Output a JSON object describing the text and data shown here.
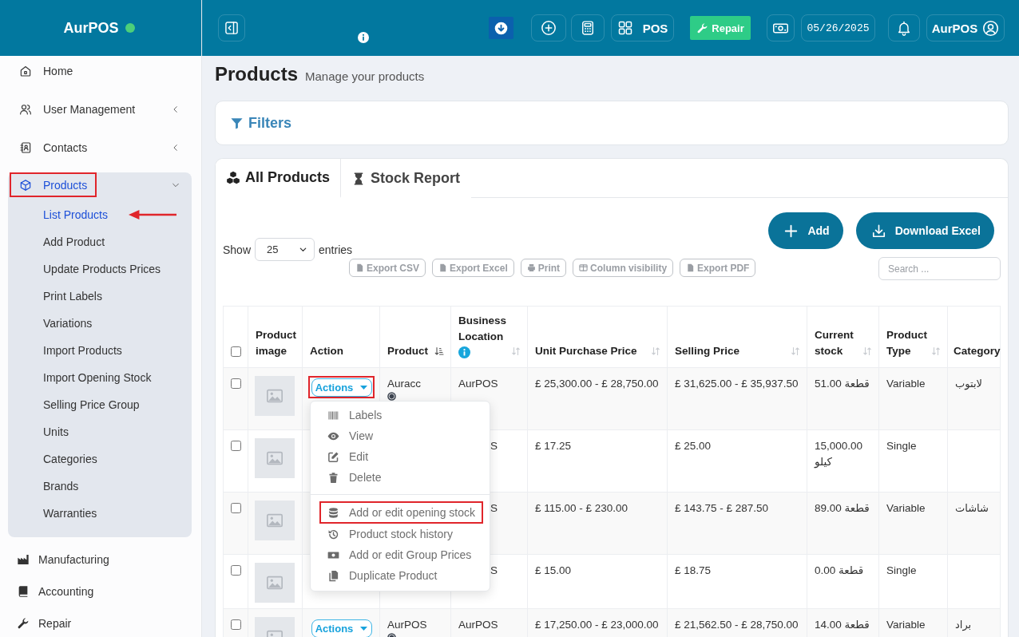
{
  "topbar": {
    "brand": "AurPOS",
    "online": true,
    "pos_label": "POS",
    "repair_label": "Repair",
    "date": "05/26/2025",
    "user": "AurPOS"
  },
  "sidebar": {
    "items": [
      {
        "label": "Home",
        "selected": false,
        "highlighted": false
      },
      {
        "label": "User Management",
        "selected": false,
        "highlighted": false,
        "expanded": false
      },
      {
        "label": "Contacts",
        "selected": false,
        "highlighted": false,
        "expanded": false
      },
      {
        "label": "Products",
        "selected": true,
        "highlighted": true,
        "expanded": true,
        "children": [
          {
            "label": "List Products",
            "selected": true,
            "arrow": true
          },
          {
            "label": "Add Product",
            "selected": false,
            "arrow": false
          },
          {
            "label": "Update Products Prices",
            "selected": false,
            "arrow": false
          },
          {
            "label": "Print Labels",
            "selected": false,
            "arrow": false
          },
          {
            "label": "Variations",
            "selected": false,
            "arrow": false
          },
          {
            "label": "Import Products",
            "selected": false,
            "arrow": false
          },
          {
            "label": "Import Opening Stock",
            "selected": false,
            "arrow": false
          },
          {
            "label": "Selling Price Group",
            "selected": false,
            "arrow": false
          },
          {
            "label": "Units",
            "selected": false,
            "arrow": false
          },
          {
            "label": "Categories",
            "selected": false,
            "arrow": false
          },
          {
            "label": "Brands",
            "selected": false,
            "arrow": false
          },
          {
            "label": "Warranties",
            "selected": false,
            "arrow": false
          }
        ]
      },
      {
        "label": "Manufacturing",
        "selected": false,
        "highlighted": false
      },
      {
        "label": "Accounting",
        "selected": false,
        "highlighted": false
      },
      {
        "label": "Repair",
        "selected": false,
        "highlighted": false
      }
    ]
  },
  "page": {
    "title": "Products",
    "subtitle": "Manage your products"
  },
  "filters": {
    "label": "Filters"
  },
  "tabs": [
    {
      "label": "All Products",
      "selected": true
    },
    {
      "label": "Stock Report",
      "selected": false
    }
  ],
  "panel": {
    "buttons": [
      "Add",
      "Download Excel"
    ],
    "show_label": "Show",
    "page_size": "25",
    "entries_label": "entries",
    "export_buttons": [
      "Export CSV",
      "Export Excel",
      "Print",
      "Column visibility",
      "Export PDF"
    ],
    "search": {
      "placeholder": "Search ..."
    }
  },
  "table": {
    "select_all": {
      "checked": false
    },
    "columns": [
      {
        "label": "Product image"
      },
      {
        "label": "Action"
      },
      {
        "label": "Product",
        "sorted": true
      },
      {
        "label": "Business Location",
        "sorted": false,
        "info": true
      },
      {
        "label": "Unit Purchase Price",
        "sorted": false
      },
      {
        "label": "Selling Price",
        "sorted": false
      },
      {
        "label": "Current stock",
        "sorted": false
      },
      {
        "label": "Product Type",
        "sorted": false
      },
      {
        "label": "Category"
      }
    ],
    "rows": [
      {
        "checked": false,
        "covered": false,
        "actions_label": "Actions",
        "highlighted": true,
        "menu_open": true,
        "menu_groups": [
          [
            {
              "label": "Labels",
              "highlighted": false
            },
            {
              "label": "View",
              "highlighted": false
            },
            {
              "label": "Edit",
              "highlighted": false
            },
            {
              "label": "Delete",
              "highlighted": false
            }
          ],
          [
            {
              "label": "Add or edit opening stock",
              "highlighted": true
            },
            {
              "label": "Product stock history",
              "highlighted": false
            },
            {
              "label": "Add or edit Group Prices",
              "highlighted": false
            },
            {
              "label": "Duplicate Product",
              "highlighted": false
            }
          ]
        ],
        "product": "Auracc",
        "site_badge": true,
        "location": "AurPOS",
        "purchase_price": "£ 25,300.00 - £ 28,750.00",
        "selling_price": "£ 31,625.00 - £ 35,937.50",
        "stock": "51.00 قطعة",
        "type": "Variable",
        "category": "لابتوب"
      },
      {
        "checked": false,
        "covered": true,
        "location": "S",
        "purchase_price": "£ 17.25",
        "selling_price": "£ 25.00",
        "stock": "15,000.00 كيلو",
        "type": "Single"
      },
      {
        "checked": false,
        "covered": true,
        "location": "S",
        "purchase_price": "£ 115.00 - £ 230.00",
        "selling_price": "£ 143.75 - £ 287.50",
        "stock": "89.00 قطعة",
        "type": "Variable",
        "category": "شاشات"
      },
      {
        "checked": false,
        "covered": true,
        "location": "S",
        "purchase_price": "£ 15.00",
        "selling_price": "£ 18.75",
        "stock": "0.00 قطعة",
        "type": "Single"
      },
      {
        "checked": false,
        "covered": false,
        "actions_label": "Actions",
        "highlighted": false,
        "menu_open": false,
        "product": "AurPOS",
        "site_badge": true,
        "location": "AurPOS",
        "purchase_price": "£ 17,250.00 - £ 23,000.00",
        "selling_price": "£ 21,562.50 - £ 28,750.00",
        "stock": "14.00 قطعة",
        "type": "Variable",
        "category": "براد"
      }
    ]
  }
}
